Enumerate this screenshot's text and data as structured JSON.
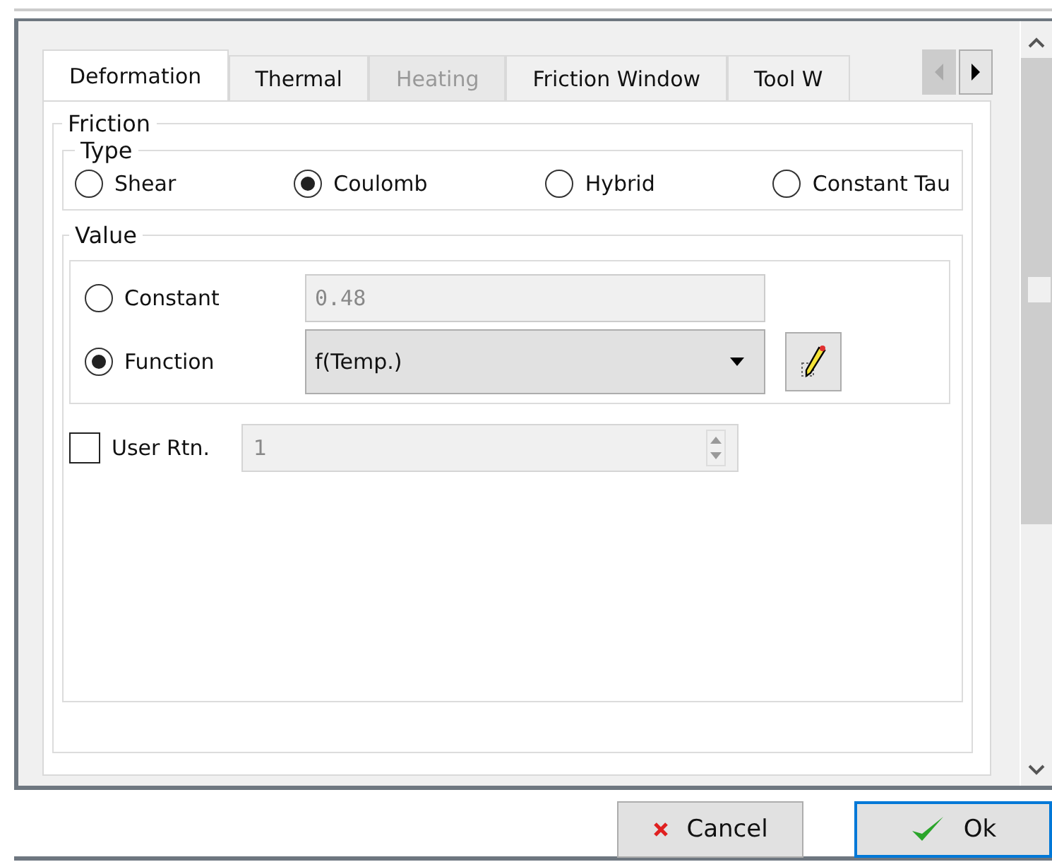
{
  "tabs": [
    {
      "label": "Deformation",
      "selected": true,
      "disabled": false
    },
    {
      "label": "Thermal",
      "selected": false,
      "disabled": false
    },
    {
      "label": "Heating",
      "selected": false,
      "disabled": true
    },
    {
      "label": "Friction Window",
      "selected": false,
      "disabled": false
    },
    {
      "label": "Tool W",
      "selected": false,
      "disabled": false
    }
  ],
  "friction": {
    "title": "Friction",
    "type": {
      "title": "Type",
      "options": [
        {
          "label": "Shear",
          "selected": false
        },
        {
          "label": "Coulomb",
          "selected": true
        },
        {
          "label": "Hybrid",
          "selected": false
        },
        {
          "label": "Constant Tau",
          "selected": false
        }
      ]
    },
    "value": {
      "title": "Value",
      "constant": {
        "label": "Constant",
        "selected": false,
        "value": "0.48",
        "disabled": true
      },
      "function": {
        "label": "Function",
        "selected": true,
        "value": "f(Temp.)"
      },
      "user_routine": {
        "label": "User Rtn.",
        "checked": false,
        "value": "1",
        "disabled": true
      }
    }
  },
  "buttons": [
    {
      "kind": "cancel",
      "label": "Cancel",
      "focused": false
    },
    {
      "kind": "ok",
      "label": "Ok",
      "focused": true
    }
  ]
}
